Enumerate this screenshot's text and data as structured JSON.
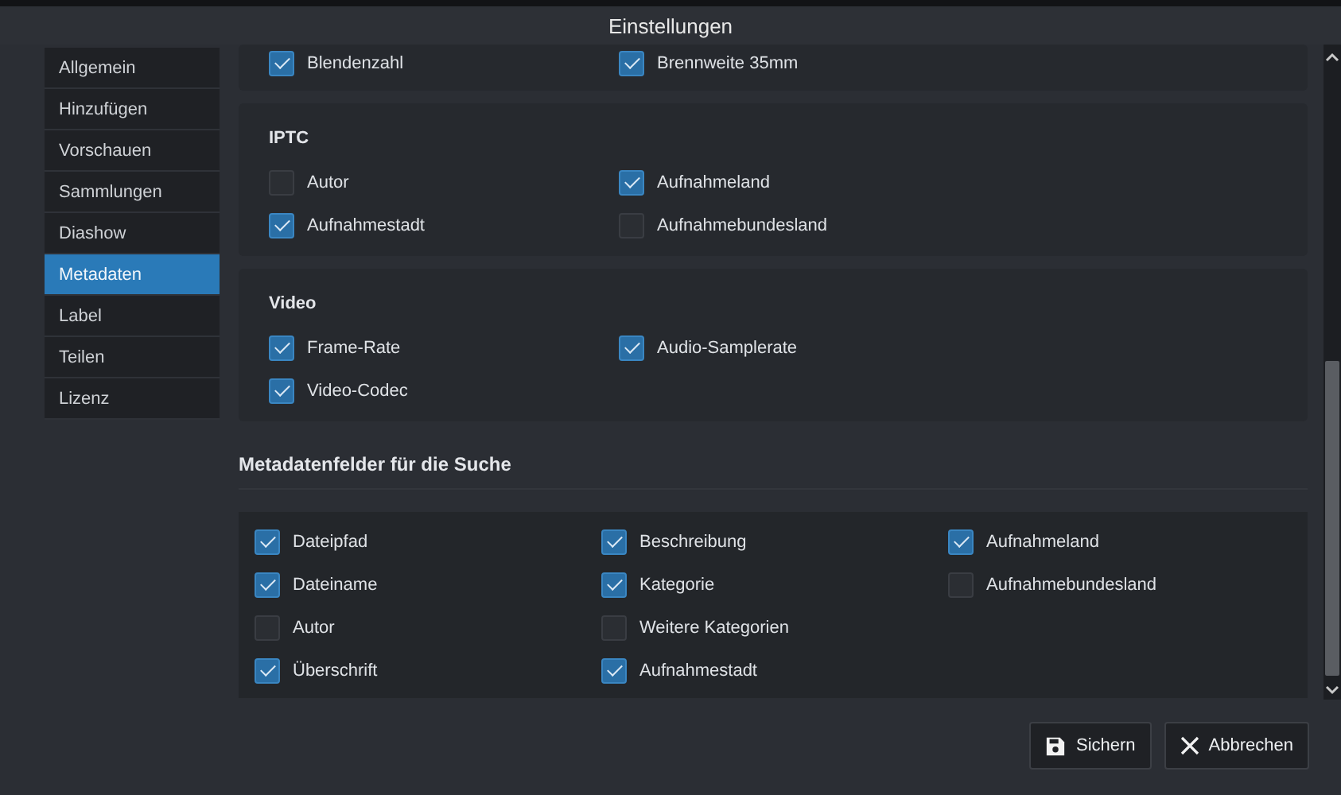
{
  "window": {
    "title": "Einstellungen"
  },
  "sidebar": {
    "items": [
      {
        "label": "Allgemein",
        "selected": false
      },
      {
        "label": "Hinzufügen",
        "selected": false
      },
      {
        "label": "Vorschauen",
        "selected": false
      },
      {
        "label": "Sammlungen",
        "selected": false
      },
      {
        "label": "Diashow",
        "selected": false
      },
      {
        "label": "Metadaten",
        "selected": true
      },
      {
        "label": "Label",
        "selected": false
      },
      {
        "label": "Teilen",
        "selected": false
      },
      {
        "label": "Lizenz",
        "selected": false
      }
    ]
  },
  "sections": [
    {
      "options": [
        {
          "label": "Blendenzahl",
          "checked": true
        },
        {
          "label": "Brennweite 35mm",
          "checked": true
        }
      ]
    },
    {
      "title": "IPTC",
      "options": [
        {
          "label": "Autor",
          "checked": false
        },
        {
          "label": "Aufnahmeland",
          "checked": true
        },
        {
          "label": "Aufnahmestadt",
          "checked": true
        },
        {
          "label": "Aufnahmebundesland",
          "checked": false
        }
      ]
    },
    {
      "title": "Video",
      "options": [
        {
          "label": "Frame-Rate",
          "checked": true
        },
        {
          "label": "Audio-Samplerate",
          "checked": true
        },
        {
          "label": "Video-Codec",
          "checked": true
        }
      ]
    }
  ],
  "search_fields": {
    "title": "Metadatenfelder für die Suche",
    "columns": [
      [
        {
          "label": "Dateipfad",
          "checked": true
        },
        {
          "label": "Dateiname",
          "checked": true
        },
        {
          "label": "Autor",
          "checked": false
        },
        {
          "label": "Überschrift",
          "checked": true
        }
      ],
      [
        {
          "label": "Beschreibung",
          "checked": true
        },
        {
          "label": "Kategorie",
          "checked": true
        },
        {
          "label": "Weitere Kategorien",
          "checked": false
        },
        {
          "label": "Aufnahmestadt",
          "checked": true
        }
      ],
      [
        {
          "label": "Aufnahmeland",
          "checked": true
        },
        {
          "label": "Aufnahmebundesland",
          "checked": false
        }
      ]
    ]
  },
  "buttons": [
    {
      "kind": "save",
      "label": "Sichern"
    },
    {
      "kind": "cancel",
      "label": "Abbrechen"
    }
  ]
}
